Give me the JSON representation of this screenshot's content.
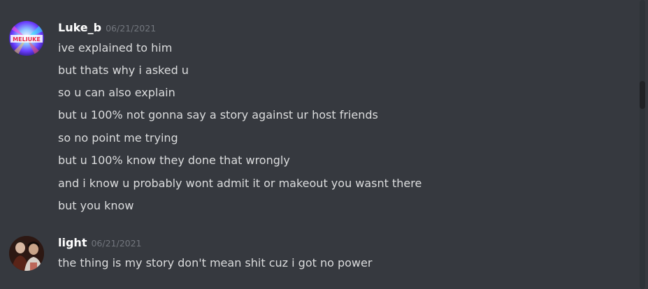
{
  "messages": [
    {
      "author": "Luke_b",
      "timestamp": "06/21/2021",
      "avatar_icon": "luke-avatar",
      "avatar_text": "MELIUKE",
      "lines": [
        "ive explained to him",
        "but thats why i asked u",
        "so u can also explain",
        "but u 100% not gonna say a story against ur host friends",
        "so no point me trying",
        "but u 100% know they done that wrongly",
        "and i know u probably wont admit it or makeout you wasnt there",
        "but you know"
      ]
    },
    {
      "author": "light",
      "timestamp": "06/21/2021",
      "avatar_icon": "light-avatar",
      "lines": [
        "the thing is my story don't mean shit cuz i got no power"
      ]
    }
  ],
  "colors": {
    "background": "#36393f",
    "username": "#ffffff",
    "timestamp": "#72767d",
    "message_text": "#dcddde",
    "scrollbar_track": "#2e3338",
    "scrollbar_thumb": "#202225"
  }
}
